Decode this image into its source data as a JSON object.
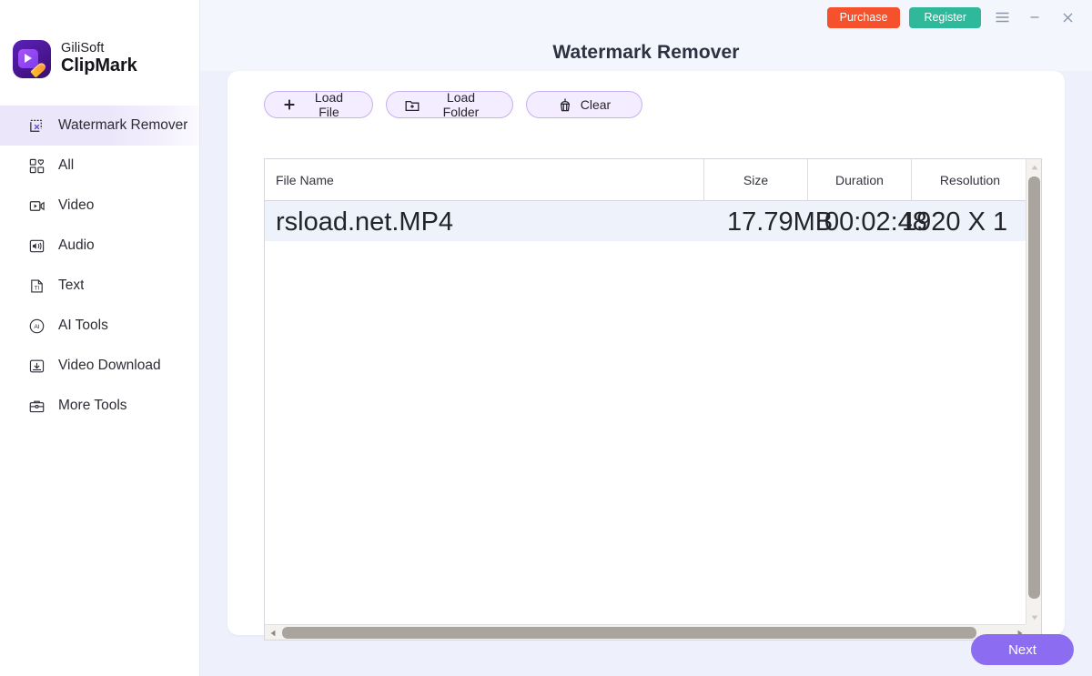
{
  "brand": {
    "line1": "GiliSoft",
    "line2": "ClipMark",
    "logo_icon": "clipmark-logo-icon"
  },
  "sidebar": {
    "items": [
      {
        "label": "Watermark Remover",
        "icon": "watermark-remove-icon",
        "active": true
      },
      {
        "label": "All",
        "icon": "grid-heart-icon",
        "active": false
      },
      {
        "label": "Video",
        "icon": "video-icon",
        "active": false
      },
      {
        "label": "Audio",
        "icon": "audio-icon",
        "active": false
      },
      {
        "label": "Text",
        "icon": "text-file-icon",
        "active": false
      },
      {
        "label": "AI Tools",
        "icon": "ai-circle-icon",
        "active": false
      },
      {
        "label": "Video Download",
        "icon": "download-icon",
        "active": false
      },
      {
        "label": "More Tools",
        "icon": "briefcase-icon",
        "active": false
      }
    ]
  },
  "topbar": {
    "purchase_label": "Purchase",
    "register_label": "Register",
    "menu_icon": "hamburger-menu-icon",
    "minimize_icon": "minimize-icon",
    "close_icon": "close-icon",
    "purchase_color": "#f4512c",
    "register_color": "#2fb89a"
  },
  "header": {
    "title": "Watermark Remover"
  },
  "toolbar": {
    "load_file_label": "Load File",
    "load_file_icon": "plus-icon",
    "load_folder_label": "Load Folder",
    "load_folder_icon": "folder-plus-icon",
    "clear_label": "Clear",
    "clear_icon": "broom-icon",
    "accent_color": "#8c6cf0"
  },
  "table": {
    "columns": [
      "File Name",
      "Size",
      "Duration",
      "Resolution"
    ],
    "rows": [
      {
        "file_name": "rsload.net.MP4",
        "size": "17.79MB",
        "duration": "00:02:48",
        "resolution": "1920 X 1"
      }
    ]
  },
  "scrollbars": {
    "vertical_up_icon": "triangle-up-icon",
    "vertical_down_icon": "triangle-down-icon",
    "horizontal_left_icon": "triangle-left-icon",
    "horizontal_right_icon": "triangle-right-icon"
  },
  "footer": {
    "next_label": "Next",
    "next_color": "#8c6cf0"
  }
}
